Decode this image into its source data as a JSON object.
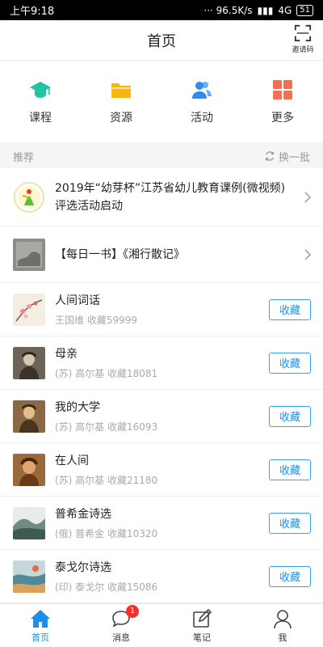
{
  "status_bar": {
    "time": "上午9:18",
    "network": "··· 96.5K/s",
    "signal": "4G",
    "battery": "51"
  },
  "header": {
    "title": "首页",
    "invite_label": "邀请码"
  },
  "categories": [
    {
      "label": "课程",
      "icon": "graduation-cap-icon",
      "color": "#23c3a1"
    },
    {
      "label": "资源",
      "icon": "folder-icon",
      "color": "#f7b614"
    },
    {
      "label": "活动",
      "icon": "users-icon",
      "color": "#2d8cf0"
    },
    {
      "label": "更多",
      "icon": "grid-icon",
      "color": "#f46e52"
    }
  ],
  "section": {
    "title": "推荐",
    "refresh_label": "换一批"
  },
  "promos": [
    {
      "text": "2019年“幼芽杯”江苏省幼儿教育课例(微视频)评选活动启动"
    },
    {
      "text": "【每日一书】《湘行散记》"
    }
  ],
  "books": [
    {
      "title": "人间词话",
      "meta": "王国维 收藏59999",
      "action": "收藏"
    },
    {
      "title": "母亲",
      "meta": "(苏) 高尔基 收藏18081",
      "action": "收藏"
    },
    {
      "title": "我的大学",
      "meta": "(苏) 高尔基 收藏16093",
      "action": "收藏"
    },
    {
      "title": "在人间",
      "meta": "(苏) 高尔基 收藏21180",
      "action": "收藏"
    },
    {
      "title": "普希金诗选",
      "meta": "(俄) 普希金 收藏10320",
      "action": "收藏"
    },
    {
      "title": "泰戈尔诗选",
      "meta": "(印) 泰戈尔 收藏15086",
      "action": "收藏"
    }
  ],
  "bottom_nav": [
    {
      "label": "首页",
      "icon": "home-icon",
      "active": true
    },
    {
      "label": "消息",
      "icon": "chat-icon",
      "badge": "1"
    },
    {
      "label": "笔记",
      "icon": "note-icon"
    },
    {
      "label": "我",
      "icon": "profile-icon"
    }
  ],
  "colors": {
    "accent": "#1e8fe6",
    "badge": "#ff2a2a"
  }
}
